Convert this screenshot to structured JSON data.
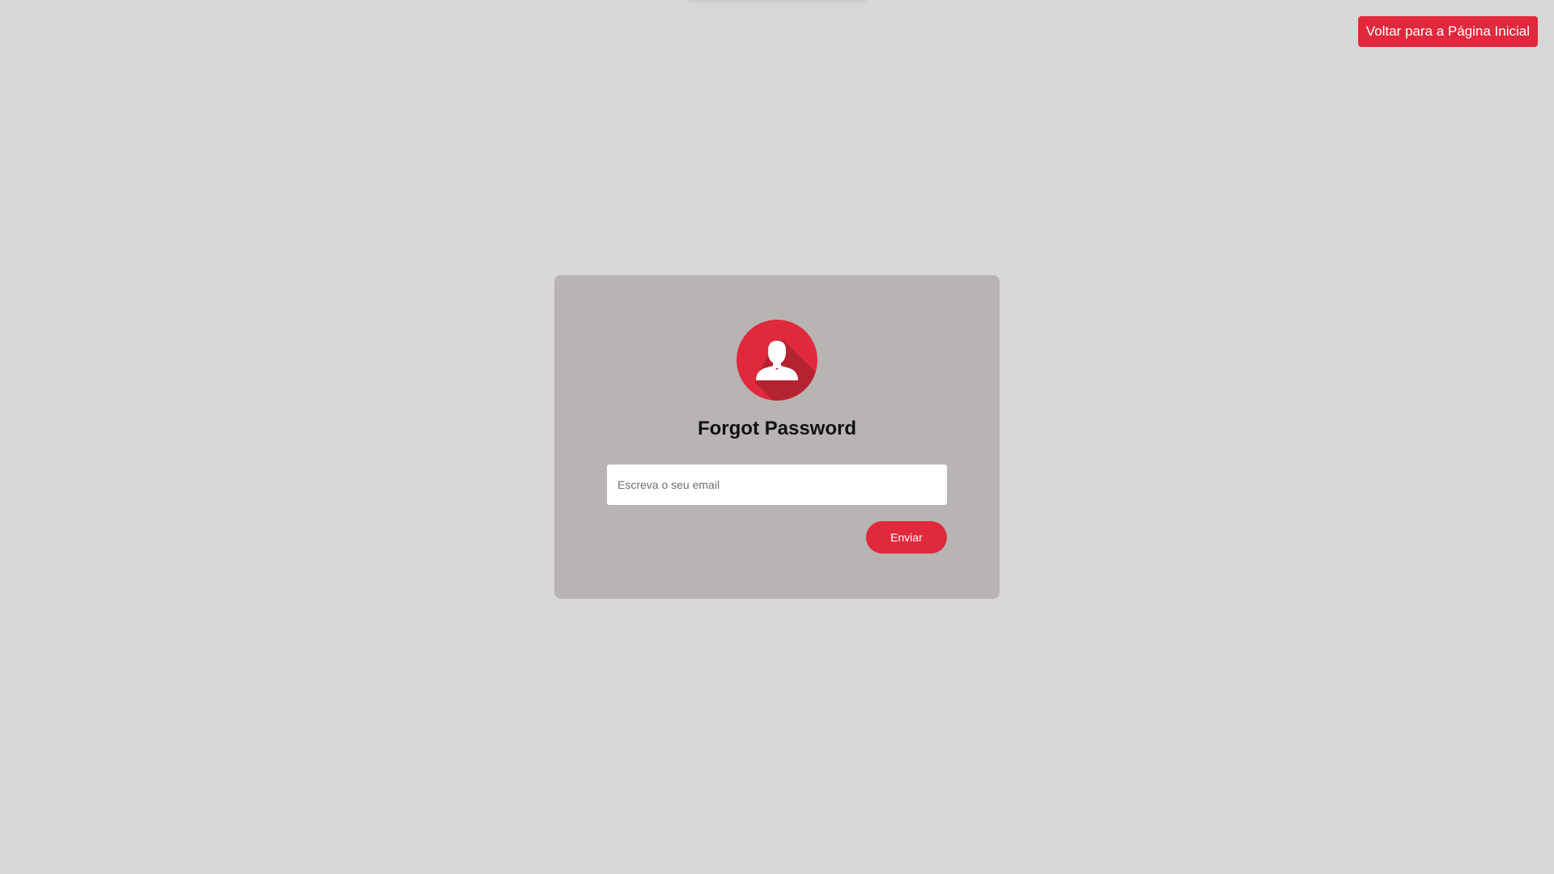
{
  "header": {
    "home_button_label": "Voltar para a Página Inicial"
  },
  "form": {
    "title": "Forgot Password",
    "email_placeholder": "Escreva o seu email",
    "email_value": "",
    "submit_label": "Enviar",
    "avatar_icon": "user-icon"
  },
  "colors": {
    "accent": "#e0293c",
    "card_background": "#b8b4b3",
    "page_background": "#d8d8d8"
  }
}
